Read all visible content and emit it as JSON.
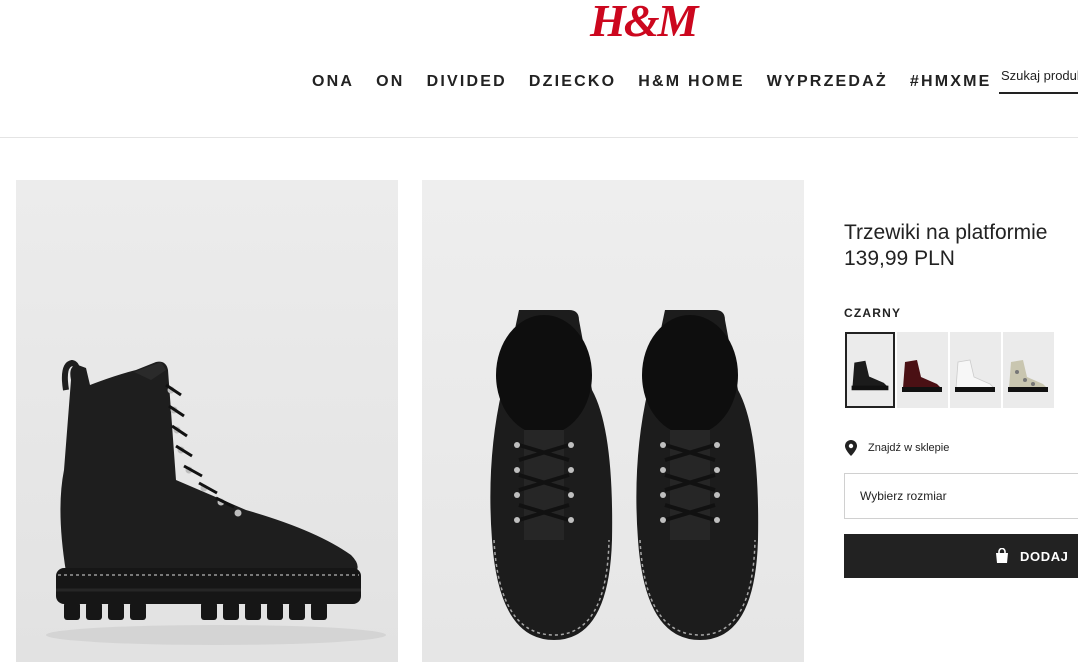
{
  "header": {
    "logo": "H&M",
    "nav": [
      "ONA",
      "ON",
      "DIVIDED",
      "DZIECKO",
      "H&M HOME",
      "WYPRZEDAŻ",
      "#HMXME"
    ],
    "search_placeholder": "Szukaj produktów"
  },
  "product": {
    "title": "Trzewiki na platformie",
    "price": "139,99 PLN",
    "color_label": "CZARNY",
    "swatches": [
      {
        "name": "black",
        "color": "#1b1b1b"
      },
      {
        "name": "burgundy",
        "color": "#4a1014"
      },
      {
        "name": "white",
        "color": "#f2f2f2"
      },
      {
        "name": "snake",
        "color": "#c9c6b0"
      }
    ],
    "store_link": "Znajdź w sklepie",
    "size_placeholder": "Wybierz rozmiar",
    "add_button": "DODAJ"
  },
  "colors": {
    "brand_red": "#cc071e",
    "button_bg": "#222222"
  }
}
